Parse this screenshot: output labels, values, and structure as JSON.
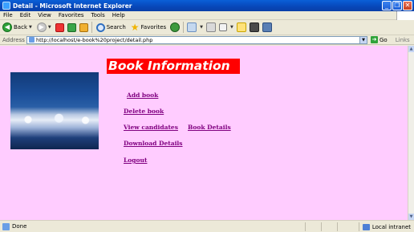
{
  "window": {
    "title": "Detail - Microsoft Internet Explorer",
    "controls": [
      "_",
      "❐",
      "✕"
    ]
  },
  "menu": [
    "File",
    "Edit",
    "View",
    "Favorites",
    "Tools",
    "Help"
  ],
  "toolbar": {
    "back_label": "Back",
    "search_label": "Search",
    "favorites_label": "Favorites"
  },
  "address": {
    "label": "Address",
    "value": "http://localhost/e-book%20project/detail.php",
    "go_label": "Go",
    "links_label": "Links"
  },
  "page": {
    "background": "#ffccff",
    "header": "Book Information",
    "header_bg": "#ff0000",
    "link_color": "#800080",
    "links": {
      "add_book": "Add book",
      "delete_book": "Delete book",
      "view_candidates": "View candidates",
      "book_details": "Book Details",
      "download_details": "Download Details",
      "logout": "Logout"
    }
  },
  "status": {
    "text": "Done",
    "zone": "Local intranet"
  }
}
